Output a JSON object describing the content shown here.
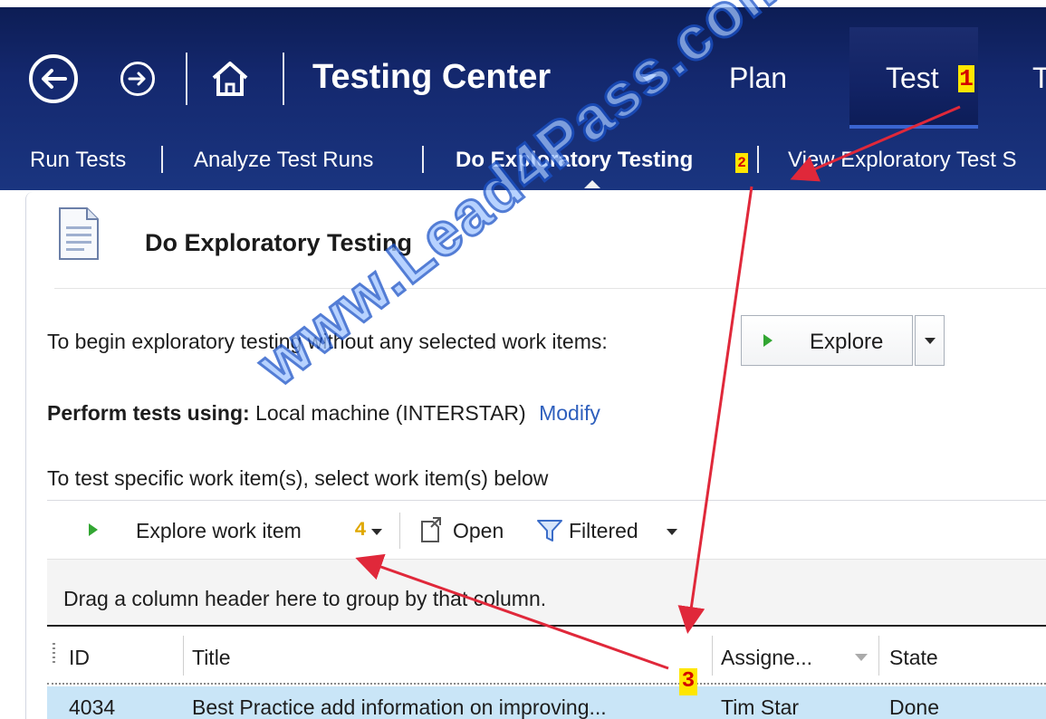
{
  "nav": {
    "app_title": "Testing Center",
    "plan": "Plan",
    "test": "Test",
    "partial_next": "T",
    "marker_1": "1"
  },
  "subnav": {
    "run_tests": "Run Tests",
    "analyze": "Analyze Test Runs",
    "do_exploratory": "Do Exploratory Testing",
    "view_exploratory": "View Exploratory Test S",
    "marker_2": "2"
  },
  "page": {
    "heading": "Do Exploratory Testing",
    "begin_text": "To begin exploratory testing without any selected work items:",
    "explore_label": "Explore",
    "perform_label": "Perform tests using:",
    "perform_value": "Local machine (INTERSTAR)",
    "modify_link": "Modify",
    "specific_text": "To test specific work item(s), select work item(s) below"
  },
  "toolbar": {
    "explore_work_item": "Explore work item",
    "marker_4": "4",
    "open": "Open",
    "filtered": "Filtered"
  },
  "grid": {
    "group_hint": "Drag a column header here to group by that column.",
    "columns": [
      "ID",
      "Title",
      "Assigne...",
      "State"
    ],
    "rows": [
      {
        "id": "4034",
        "title": "Best Practice add information on improving...",
        "assigned": "Tim Star",
        "state": "Done"
      }
    ],
    "marker_3": "3"
  },
  "watermark": "www.Lead4Pass.com",
  "colors": {
    "nav_bg": "#14286e",
    "link": "#2e5fbd",
    "selected_row": "#c9e5f7",
    "marker_bg": "#ffe600",
    "annotation_arrow": "#e0283a"
  }
}
